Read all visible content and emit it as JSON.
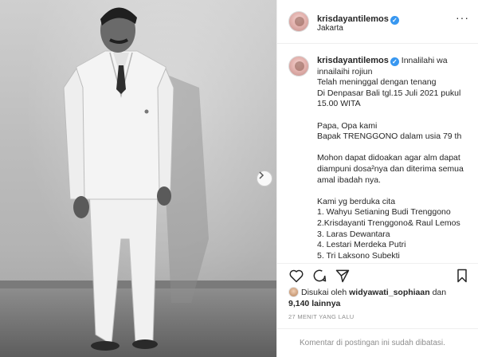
{
  "post": {
    "username": "krisdayantilemos",
    "location": "Jakarta",
    "verified_symbol": "✓",
    "more_label": "···",
    "caption_lead": "Innalilahi wa innailaihi rojiun",
    "caption_body": "Telah meninggal dengan tenang\nDi Denpasar Bali tgl.15 Juli 2021 pukul 15.00 WITA\n\nPapa, Opa kami\nBapak TRENGGONO dalam usia 79 th\n\nMohon dapat didoakan agar alm dapat diampuni dosa²nya dan diterima semua amal ibadah nya.\n\nKami yg berduka cita\n1. Wahyu Setianing Budi Trenggono\n2.Krisdayanti Trenggono& Raul Lemos\n3. Laras Dewantara\n4. Lestari Merdeka Putri\n5. Tri Laksono Subekti",
    "likes_prefix": "Disukai oleh",
    "liked_by_user": "widyawati_sophiaan",
    "likes_joiner": "dan",
    "likes_count": "9,140 lainnya",
    "timestamp": "27 MENIT YANG LALU",
    "comments_disabled": "Komentar di postingan ini sudah dibatasi."
  },
  "icons": {
    "like": "heart-icon",
    "comment": "comment-icon",
    "share": "share-icon",
    "save": "bookmark-icon",
    "next": "chevron-right-icon"
  },
  "colors": {
    "verified": "#3897f0",
    "text": "#262626",
    "muted": "#8e8e8e",
    "divider": "#efefef"
  }
}
